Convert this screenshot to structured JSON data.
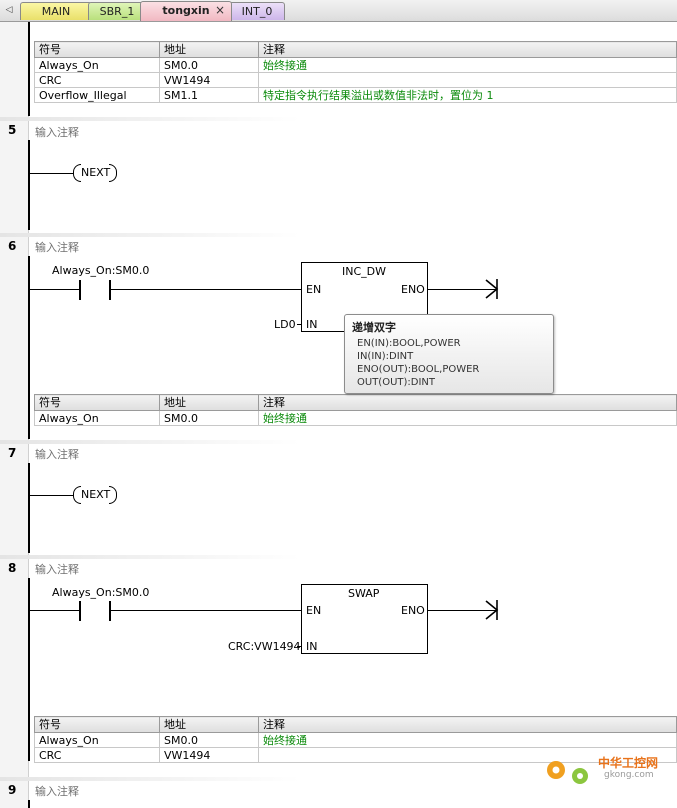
{
  "tabs": {
    "main": "MAIN",
    "sbr": "SBR_1",
    "tongxin": "tongxin",
    "int": "INT_0",
    "close_glyph": "×",
    "scroll_glyph": "◁"
  },
  "table_headers": {
    "symbol": "符号",
    "address": "地址",
    "comment": "注释"
  },
  "table_top": [
    {
      "symbol": "Always_On",
      "address": "SM0.0",
      "comment": "始终接通"
    },
    {
      "symbol": "CRC",
      "address": "VW1494",
      "comment": ""
    },
    {
      "symbol": "Overflow_Illegal",
      "address": "SM1.1",
      "comment": "特定指令执行结果溢出或数值非法时，置位为 1"
    }
  ],
  "networks": {
    "n5": {
      "number": "5",
      "comment": "输入注释",
      "coil": "NEXT"
    },
    "n6": {
      "number": "6",
      "comment": "输入注释",
      "contact": "Always_On:SM0.0",
      "box": "INC_DW",
      "en": "EN",
      "eno": "ENO",
      "in_label": "LD0",
      "in": "IN"
    },
    "n7": {
      "number": "7",
      "comment": "输入注释",
      "coil": "NEXT"
    },
    "n8": {
      "number": "8",
      "comment": "输入注释",
      "contact": "Always_On:SM0.0",
      "box": "SWAP",
      "en": "EN",
      "eno": "ENO",
      "in_label": "CRC:VW1494",
      "in": "IN"
    },
    "n9": {
      "number": "9",
      "comment": "输入注释"
    }
  },
  "table_n6": [
    {
      "symbol": "Always_On",
      "address": "SM0.0",
      "comment": "始终接通"
    }
  ],
  "table_n8": [
    {
      "symbol": "Always_On",
      "address": "SM0.0",
      "comment": "始终接通"
    },
    {
      "symbol": "CRC",
      "address": "VW1494",
      "comment": ""
    }
  ],
  "tooltip": {
    "title": "递增双字",
    "line1": "EN(IN):BOOL,POWER",
    "line2": "IN(IN):DINT",
    "line3": "ENO(OUT):BOOL,POWER",
    "line4": "OUT(OUT):DINT"
  },
  "watermark": {
    "text": "中华工控网",
    "sub": "gkong.com"
  },
  "colors": {
    "comment_green": "#0a8a0a",
    "tab_active": "#f1b8c2"
  }
}
